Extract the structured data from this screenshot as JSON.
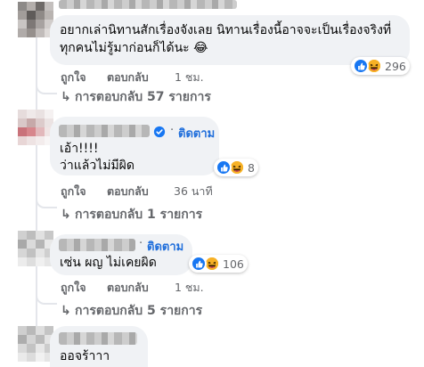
{
  "colors": {
    "link_blue": "#216fdb",
    "muted": "#65676b",
    "bubble_bg": "#f0f2f5",
    "like_blue": "#1877f2",
    "haha_yellow": "#f7b125"
  },
  "comments": [
    {
      "text_lines": [
        "อยากเล่านิทานสักเรื่องจังเลย นิทานเรื่องนี้อาจจะเป็นเรื่องจริงที่",
        "ทุกคนไม่รู้มาก่อนก็ได้นะ 😂"
      ],
      "reactions": {
        "icons": [
          "like-icon",
          "haha-icon"
        ],
        "count": "296"
      },
      "actions": {
        "like": "ถูกใจ",
        "reply": "ตอบกลับ",
        "time": "1 ชม."
      },
      "replies": "การตอบกลับ 57 รายการ"
    },
    {
      "follow": "ติดตาม",
      "verified_icon": "verified-badge-icon",
      "text_lines": [
        "เอ้า!!!!",
        "ว่าแล้วไม่มีผิด"
      ],
      "reactions": {
        "icons": [
          "like-icon",
          "haha-icon"
        ],
        "count": "8"
      },
      "actions": {
        "like": "ถูกใจ",
        "reply": "ตอบกลับ",
        "time": "36 นาที"
      },
      "replies": "การตอบกลับ 1 รายการ"
    },
    {
      "follow": "ติดตาม",
      "text_lines": [
        "เซ่น ผญ ไม่เคยผิด"
      ],
      "reactions": {
        "icons": [
          "like-icon",
          "haha-icon"
        ],
        "count": "106"
      },
      "actions": {
        "like": "ถูกใจ",
        "reply": "ตอบกลับ",
        "time": "1 ชม."
      },
      "replies": "การตอบกลับ 5 รายการ"
    },
    {
      "text_lines": [
        "ออจร้าาา"
      ]
    }
  ],
  "separator": "·",
  "reply_arrow": "↳"
}
